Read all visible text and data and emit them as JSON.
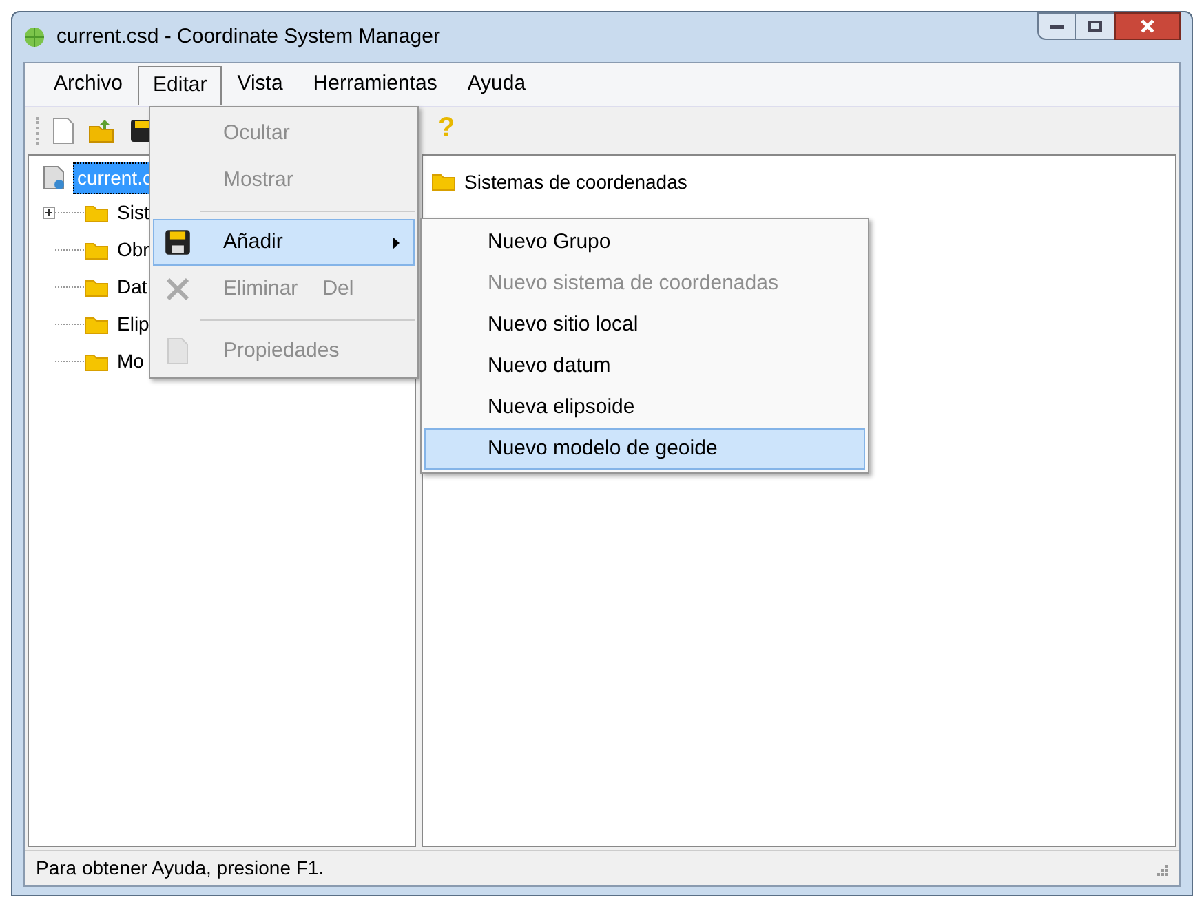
{
  "window": {
    "title": "current.csd - Coordinate System Manager"
  },
  "menubar": [
    {
      "label": "Archivo",
      "selected": false
    },
    {
      "label": "Editar",
      "selected": true
    },
    {
      "label": "Vista",
      "selected": false
    },
    {
      "label": "Herramientas",
      "selected": false
    },
    {
      "label": "Ayuda",
      "selected": false
    }
  ],
  "toolbar": [
    {
      "kind": "new"
    },
    {
      "kind": "open"
    },
    {
      "kind": "save"
    },
    {
      "kind": "help",
      "label": "?"
    }
  ],
  "tree": {
    "root": {
      "label": "current.c",
      "selected": true
    },
    "children": [
      {
        "label": "Sist",
        "expandable": true
      },
      {
        "label": "Obr",
        "expandable": false
      },
      {
        "label": "Dat",
        "expandable": false
      },
      {
        "label": "Elip",
        "expandable": false
      },
      {
        "label": "Mo",
        "expandable": false
      }
    ]
  },
  "list": [
    {
      "label": "Sistemas de coordenadas"
    }
  ],
  "edit_menu": [
    {
      "kind": "item",
      "label": "Ocultar",
      "disabled": true,
      "selected": false
    },
    {
      "kind": "item",
      "label": "Mostrar",
      "disabled": true,
      "selected": false
    },
    {
      "kind": "separator"
    },
    {
      "kind": "item",
      "label": "Añadir",
      "submenu": true,
      "disabled": false,
      "selected": true
    },
    {
      "kind": "item",
      "label": "Eliminar",
      "shortcut": "Del",
      "disabled": true,
      "selected": false
    },
    {
      "kind": "separator"
    },
    {
      "kind": "item",
      "label": "Propiedades",
      "disabled": true,
      "selected": false
    }
  ],
  "submenu": [
    {
      "label": "Nuevo Grupo",
      "disabled": false,
      "selected": false
    },
    {
      "label": "Nuevo sistema de coordenadas",
      "disabled": true,
      "selected": false
    },
    {
      "label": "Nuevo sitio local",
      "disabled": false,
      "selected": false
    },
    {
      "label": "Nuevo datum",
      "disabled": false,
      "selected": false
    },
    {
      "label": "Nueva elipsoide",
      "disabled": false,
      "selected": false
    },
    {
      "label": "Nuevo modelo de geoide",
      "disabled": false,
      "selected": true
    }
  ],
  "status_bar": "Para obtener Ayuda, presione F1."
}
